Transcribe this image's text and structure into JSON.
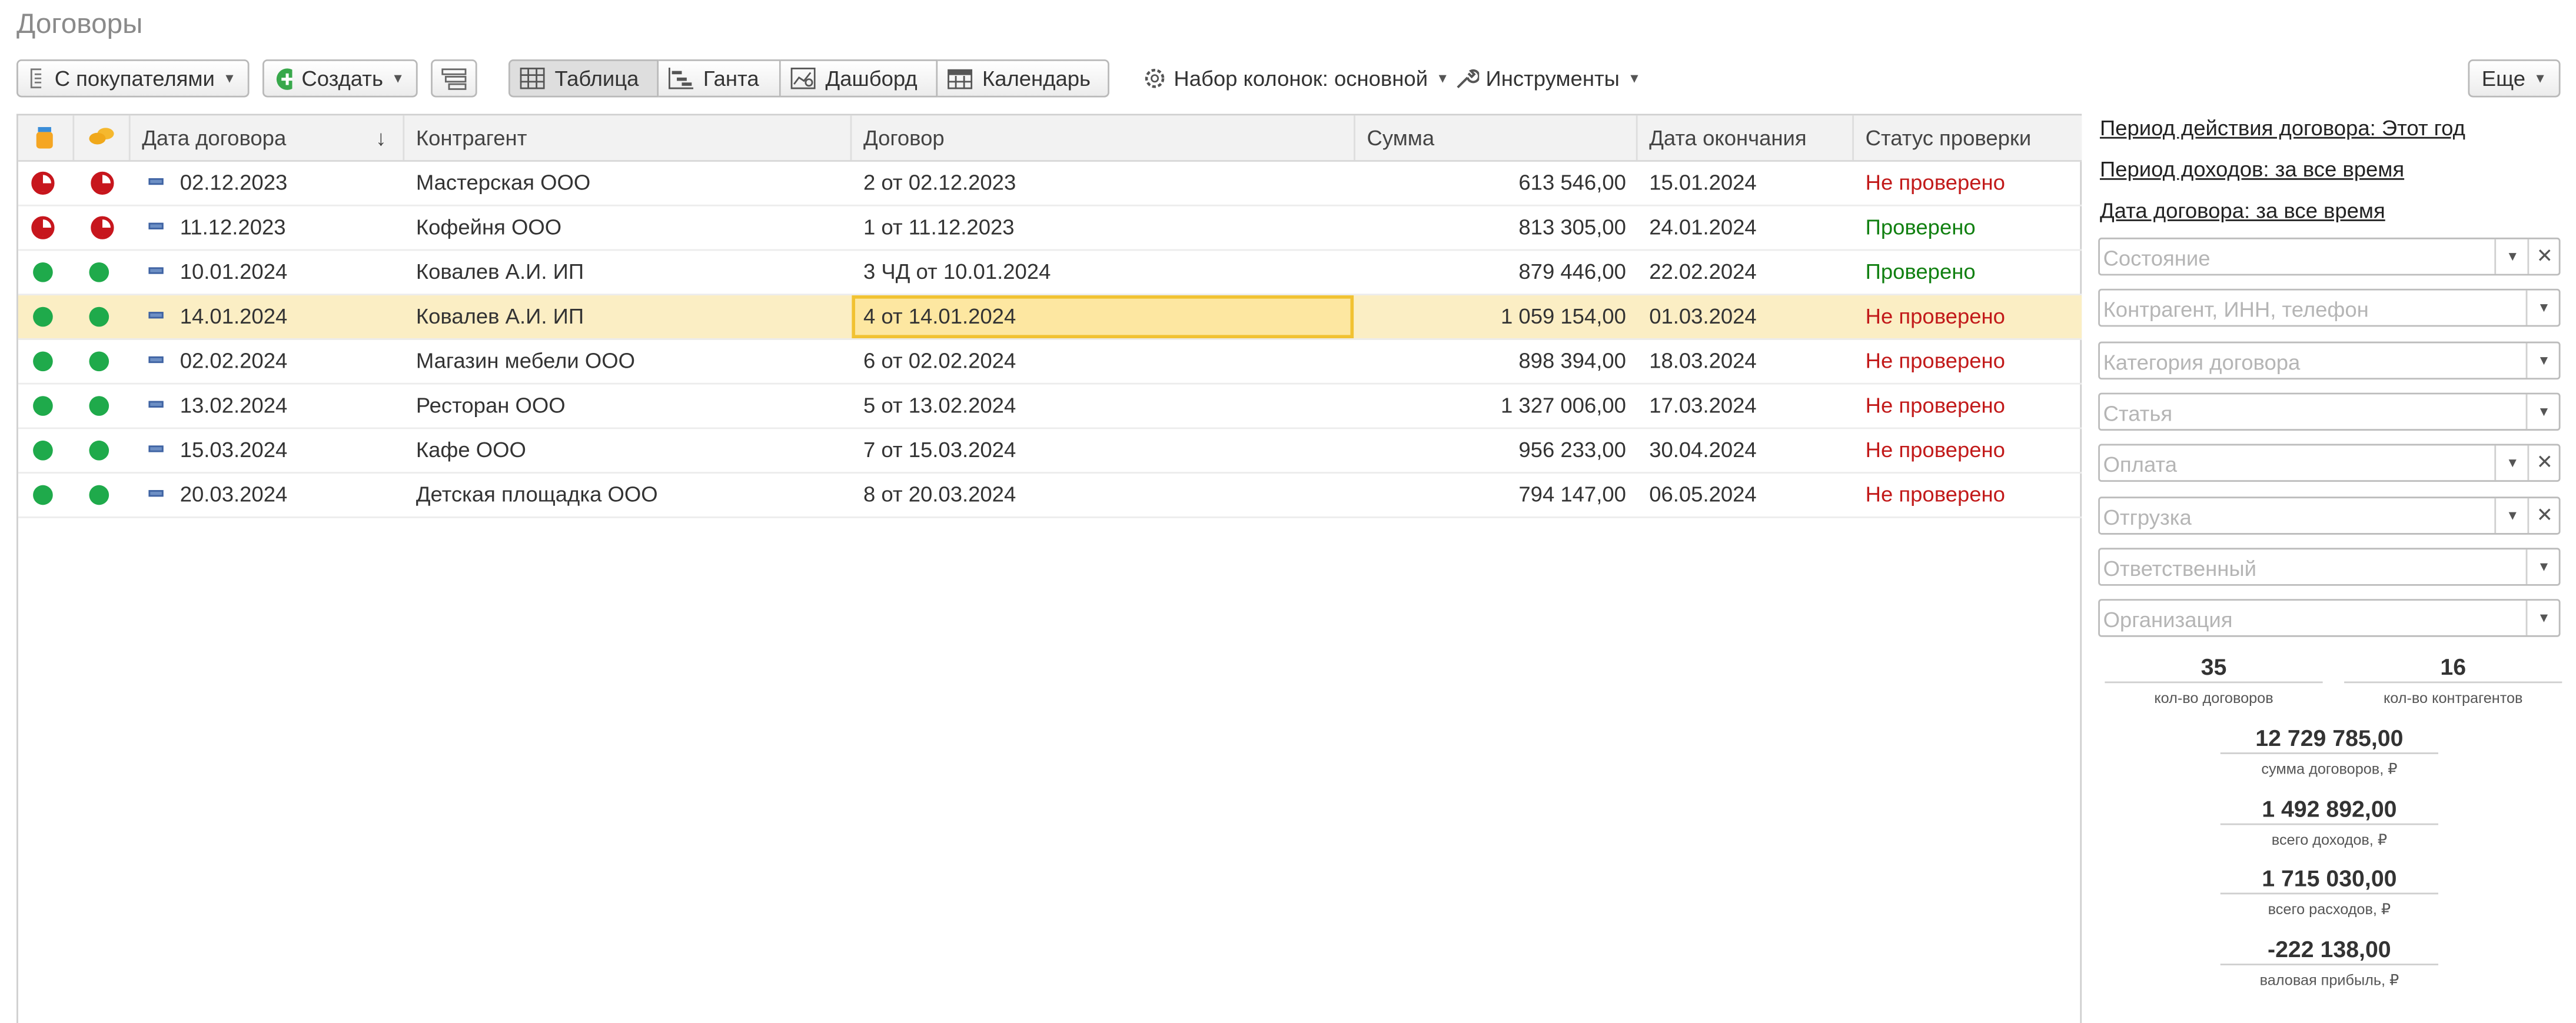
{
  "page": {
    "title": "Договоры"
  },
  "toolbar": {
    "filter_button": "С покупателями",
    "create_button": "Создать",
    "views": [
      "Таблица",
      "Ганта",
      "Дашборд",
      "Календарь"
    ],
    "columns_set": "Набор колонок: основной",
    "tools": "Инструменты",
    "more": "Еще"
  },
  "table": {
    "headers": [
      "Дата договора",
      "Контрагент",
      "Договор",
      "Сумма",
      "Дата окончания",
      "Статус проверки"
    ],
    "sort_icon": "sort-down-arrow-icon",
    "rows": [
      {
        "state": "pie",
        "date": "02.12.2023",
        "partner": "Мастерская ООО",
        "contract": "2 от 02.12.2023",
        "sum": "613 546,00",
        "end": "15.01.2024",
        "status": "Не проверено",
        "ok": false
      },
      {
        "state": "pie",
        "date": "11.12.2023",
        "partner": "Кофейня ООО",
        "contract": "1 от 11.12.2023",
        "sum": "813 305,00",
        "end": "24.01.2024",
        "status": "Проверено",
        "ok": true
      },
      {
        "state": "dot",
        "date": "10.01.2024",
        "partner": "Ковалев А.И. ИП",
        "contract": "3 ЧД от 10.01.2024",
        "sum": "879 446,00",
        "end": "22.02.2024",
        "status": "Проверено",
        "ok": true
      },
      {
        "state": "dot",
        "date": "14.01.2024",
        "partner": "Ковалев А.И. ИП",
        "contract": "4 от 14.01.2024",
        "sum": "1 059 154,00",
        "end": "01.03.2024",
        "status": "Не проверено",
        "ok": false,
        "selected": true
      },
      {
        "state": "dot",
        "date": "02.02.2024",
        "partner": "Магазин мебели ООО",
        "contract": "6 от 02.02.2024",
        "sum": "898 394,00",
        "end": "18.03.2024",
        "status": "Не проверено",
        "ok": false
      },
      {
        "state": "dot",
        "date": "13.02.2024",
        "partner": "Ресторан ООО",
        "contract": "5 от 13.02.2024",
        "sum": "1 327 006,00",
        "end": "17.03.2024",
        "status": "Не проверено",
        "ok": false
      },
      {
        "state": "dot",
        "date": "15.03.2024",
        "partner": "Кафе ООО",
        "contract": "7 от 15.03.2024",
        "sum": "956 233,00",
        "end": "30.04.2024",
        "status": "Не проверено",
        "ok": false
      },
      {
        "state": "dot",
        "date": "20.03.2024",
        "partner": "Детская площадка ООО",
        "contract": "8 от 20.03.2024",
        "sum": "794 147,00",
        "end": "06.05.2024",
        "status": "Не проверено",
        "ok": false
      }
    ]
  },
  "panel": {
    "links": [
      "Период действия договора: Этот год",
      "Период доходов: за все время",
      "Дата договора: за все время"
    ],
    "filters": [
      {
        "placeholder": "Состояние",
        "clear": true
      },
      {
        "placeholder": "Контрагент, ИНН, телефон",
        "clear": false
      },
      {
        "placeholder": "Категория договора",
        "clear": false
      },
      {
        "placeholder": "Статья",
        "clear": false
      },
      {
        "placeholder": "Оплата",
        "clear": true
      },
      {
        "placeholder": "Отгрузка",
        "clear": true
      },
      {
        "placeholder": "Ответственный",
        "clear": false
      },
      {
        "placeholder": "Организация",
        "clear": false
      }
    ],
    "counts": [
      {
        "value": "35",
        "label": "кол-во договоров"
      },
      {
        "value": "16",
        "label": "кол-во контрагентов"
      }
    ],
    "totals": [
      {
        "value": "12 729 785,00",
        "label": "сумма договоров, ₽"
      },
      {
        "value": "1 492 892,00",
        "label": "всего доходов, ₽"
      },
      {
        "value": "1 715 030,00",
        "label": "всего расходов, ₽"
      },
      {
        "value": "-222 138,00",
        "label": "валовая прибыль, ₽"
      }
    ]
  },
  "colors": {
    "green": "#1faa4b",
    "red": "#c7161d",
    "selected_row": "#fbeec4",
    "ok_text": "#118011",
    "bad_text": "#c21a1a"
  }
}
